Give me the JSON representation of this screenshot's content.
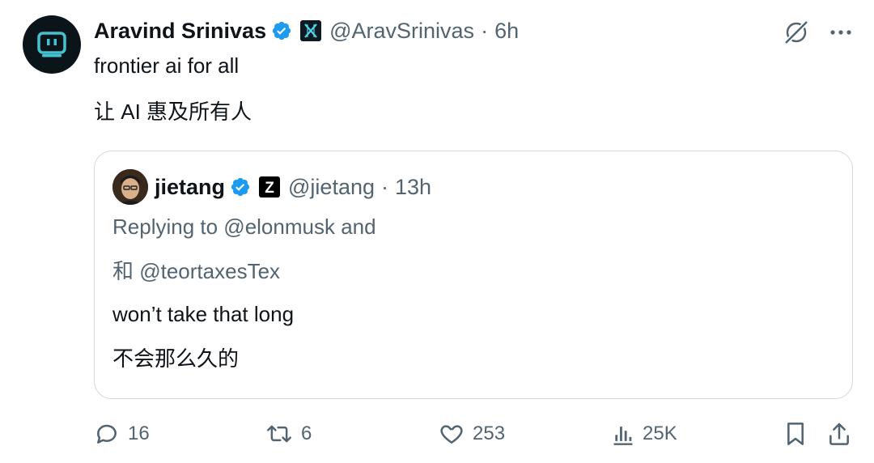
{
  "author": {
    "name": "Aravind Srinivas",
    "handle": "@AravSrinivas",
    "separator": "·",
    "time": "6h"
  },
  "tweet": {
    "lines": [
      "frontier ai for all",
      "让 AI 惠及所有人"
    ]
  },
  "quote": {
    "name": "jietang",
    "handle": "@jietang",
    "separator": "·",
    "time": "13h",
    "affiliation_badge": "Z",
    "reply_line_1": "Replying to @elonmusk and",
    "reply_line_2": "和 @teortaxesTex",
    "lines": [
      "won’t take that long",
      "不会那么久的"
    ]
  },
  "actions": {
    "replies": "16",
    "reposts": "6",
    "likes": "253",
    "views": "25K"
  },
  "colors": {
    "verified": "#1d9bf0",
    "muted": "#536471",
    "text": "#0f1419",
    "border": "#cfd9de"
  },
  "icons": [
    "verified-badge-icon",
    "grok-icon",
    "more-icon",
    "reply-icon",
    "repost-icon",
    "like-icon",
    "views-icon",
    "bookmark-icon",
    "share-icon"
  ]
}
